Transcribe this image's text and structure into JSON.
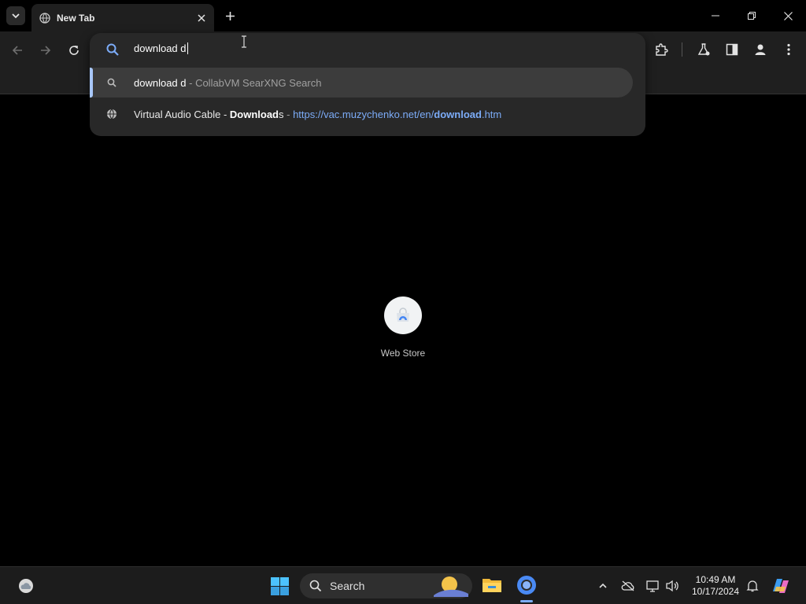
{
  "tabstrip": {
    "active_tab_title": "New Tab"
  },
  "omnibox": {
    "input_value": "download d",
    "suggestions": [
      {
        "query": "download d",
        "separator": " - ",
        "source": "CollabVM SearXNG Search",
        "icon": "search-icon"
      },
      {
        "title_prefix": "Virtual Audio Cable - ",
        "title_bold": "Download",
        "title_suffix": "s",
        "separator": " - ",
        "url_prefix": "https://vac.muzychenko.net/en/",
        "url_bold": "download",
        "url_suffix": ".htm",
        "icon": "globe-icon"
      }
    ]
  },
  "page": {
    "shortcut_label": "Web Store"
  },
  "taskbar": {
    "search_label": "Search",
    "time": "10:49 AM",
    "date": "10/17/2024"
  },
  "colors": {
    "accent": "#a8c7fa",
    "link": "#7cacf8",
    "toolbar_bg": "#1f1f1f",
    "page_bg": "#000000"
  }
}
